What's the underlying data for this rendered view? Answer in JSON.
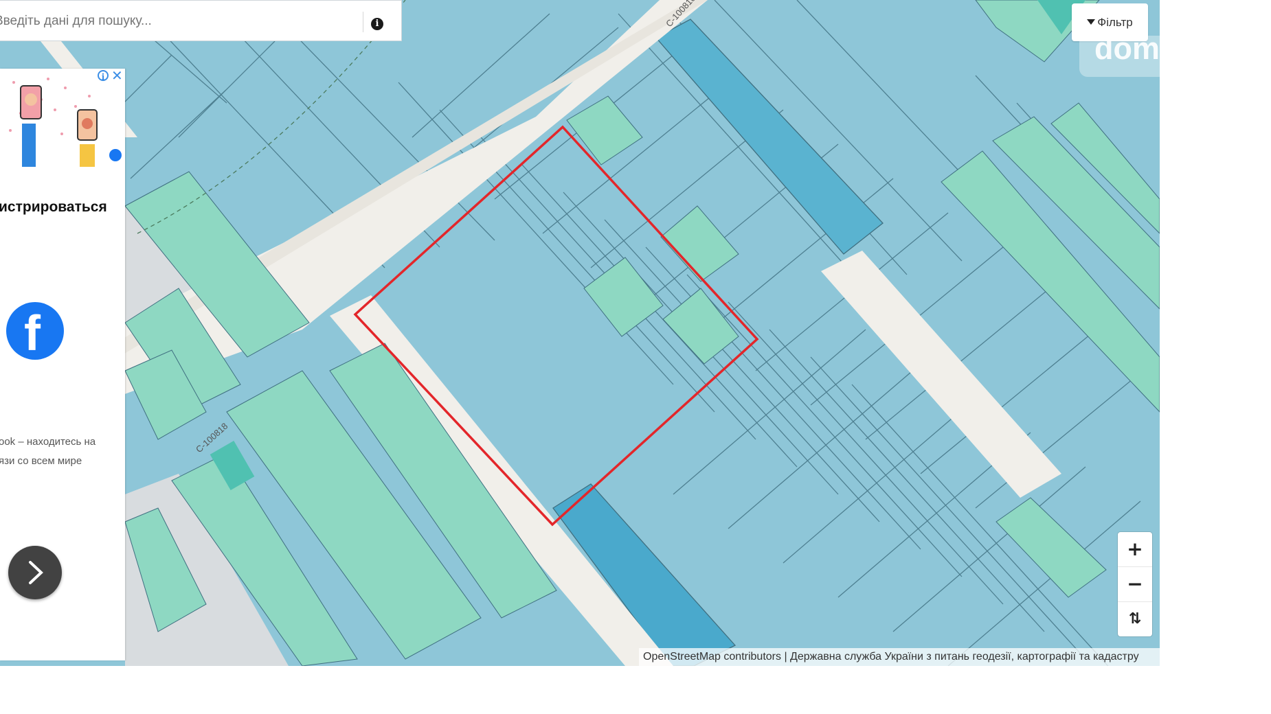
{
  "search": {
    "placeholder": "Введіть дані для пошуку...",
    "info_icon": "info-icon"
  },
  "filter": {
    "label": "Фільтр",
    "icon": "filter-icon"
  },
  "logo": {
    "text": "dom"
  },
  "map": {
    "road_label": "С-100818",
    "attribution": "OpenStreetMap contributors | Державна служба України з питань геодезії, картографії та кадастру",
    "colors": {
      "background": "#8ec6d8",
      "parcel_green": "#8ed8c2",
      "parcel_dark_blue": "#5ab3d0",
      "road": "#f1efea",
      "boundary": "#e3262a"
    }
  },
  "zoom": {
    "in": "+",
    "out": "−",
    "reset": "⇅"
  },
  "ad": {
    "title": "истрироваться",
    "desc_line1": "ook – находитесь на",
    "desc_line2": "язи со всем мире",
    "fb_letter": "f",
    "next_icon": "chevron-right-icon"
  }
}
